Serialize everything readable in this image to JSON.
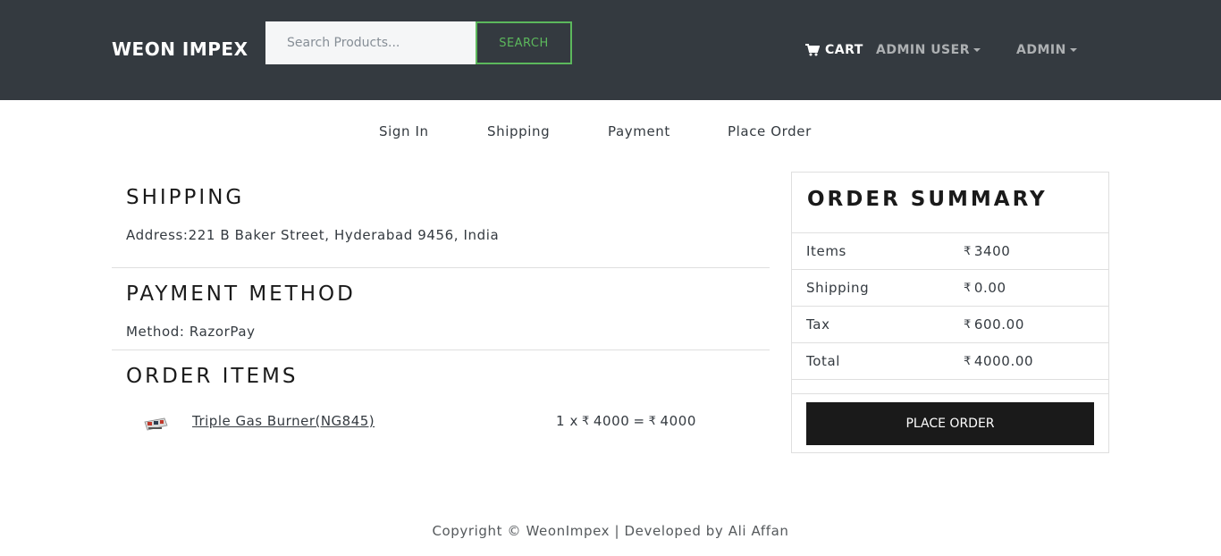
{
  "navbar": {
    "brand": "WEON IMPEX",
    "search_placeholder": "Search Products...",
    "search_label": "SEARCH",
    "cart_label": "CART",
    "user_label": "ADMIN USER",
    "admin_label": "ADMIN"
  },
  "steps": [
    "Sign In",
    "Shipping",
    "Payment",
    "Place Order"
  ],
  "shipping": {
    "title": "SHIPPING",
    "address": "Address:221 B Baker Street, Hyderabad 9456, India"
  },
  "payment": {
    "title": "PAYMENT METHOD",
    "method": "Method: RazorPay"
  },
  "order_items": {
    "title": "ORDER ITEMS",
    "items": [
      {
        "name": "Triple Gas Burner(NG845)",
        "qty_text": "1 x",
        "price": "4000",
        "equals": "=",
        "total": "4000"
      }
    ]
  },
  "summary": {
    "title": "ORDER SUMMARY",
    "currency": "₹",
    "rows": [
      {
        "label": "Items",
        "value": "3400"
      },
      {
        "label": "Shipping",
        "value": "0.00"
      },
      {
        "label": "Tax",
        "value": "600.00"
      },
      {
        "label": "Total",
        "value": "4000.00"
      }
    ],
    "place_order_label": "PLACE ORDER"
  },
  "footer": {
    "text": "Copyright © WeonImpex | Developed by Ali Affan"
  },
  "icons": {
    "cart": "shopping-cart-icon",
    "rupee": "rupee-icon"
  },
  "colors": {
    "navbar_bg": "#343a40",
    "search_accent": "#5cb85c",
    "button_dark": "#1a1a1a"
  }
}
